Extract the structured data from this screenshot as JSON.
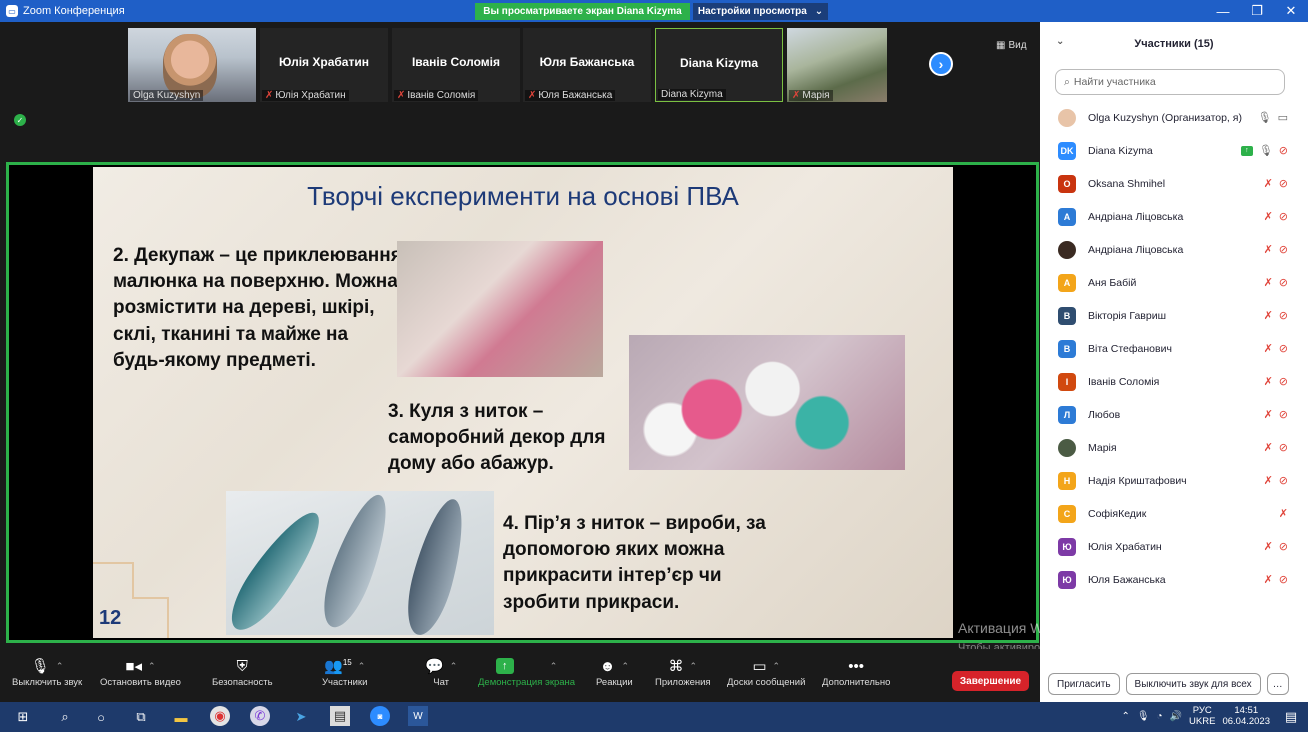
{
  "window": {
    "title": "Zoom Конференция",
    "viewing_banner": "Вы просматриваете экран Diana Kizyma",
    "view_settings": "Настройки просмотра"
  },
  "thumbnails": [
    {
      "name": "",
      "label": "Olga Kuzyshyn",
      "muted": false
    },
    {
      "name": "Юлія Храбатин",
      "label": "Юлія Храбатин",
      "muted": true
    },
    {
      "name": "Іванів Соломія",
      "label": "Іванів Соломія",
      "muted": true
    },
    {
      "name": "Юля Бажанська",
      "label": "Юля Бажанська",
      "muted": true
    },
    {
      "name": "Diana Kizyma",
      "label": "Diana Kizyma",
      "muted": false
    },
    {
      "name": "",
      "label": "Марія",
      "muted": true
    }
  ],
  "view_button": "Вид",
  "slide": {
    "title": "Творчі експерименти на основі ПВА",
    "text1": "2. Декупаж – це приклеювання малюнка на поверхню. Можна розмістити на дереві, шкірі, склі, тканині та майже на будь-якому предметі.",
    "text2": "3. Куля з ниток – саморобний декор для дому або абажур.",
    "text3": "4. Пір’я з ниток – вироби, за допомогою яких можна прикрасити інтер’єр чи зробити прикраси.",
    "number": "12"
  },
  "watermark": {
    "line1": "Активация Windows",
    "line2": "Чтобы активировать Windows, перейдите в раздел \"Параметры\"."
  },
  "toolbar": {
    "mute": "Выключить звук",
    "stop_video": "Остановить видео",
    "security": "Безопасность",
    "participants": "Участники",
    "participants_count": "15",
    "chat": "Чат",
    "share": "Демонстрация экрана",
    "reactions": "Реакции",
    "apps": "Приложения",
    "whiteboards": "Доски сообщений",
    "more": "Дополнительно",
    "end": "Завершение"
  },
  "panel": {
    "title": "Участники (15)",
    "search_placeholder": "Найти участника",
    "invite": "Пригласить",
    "mute_all": "Выключить звук для всех",
    "more": "…",
    "participants": [
      {
        "name": "Olga Kuzyshyn (Организатор, я)",
        "initial": "",
        "color": "#e8c4a8",
        "photo": true
      },
      {
        "name": "Diana Kizyma",
        "initial": "DK",
        "color": "#2d8cff"
      },
      {
        "name": "Oksana Shmihel",
        "initial": "O",
        "color": "#c9340f"
      },
      {
        "name": "Андріана Ліцовська",
        "initial": "A",
        "color": "#2d7bd6"
      },
      {
        "name": "Андріана Ліцовська",
        "initial": "",
        "color": "#3a2a22",
        "photo": true
      },
      {
        "name": "Аня Бабій",
        "initial": "A",
        "color": "#f3a51a"
      },
      {
        "name": "Вікторія Гавриш",
        "initial": "B",
        "color": "#2f4d70"
      },
      {
        "name": "Віта Стефанович",
        "initial": "B",
        "color": "#2d7bd6"
      },
      {
        "name": "Іванів Соломія",
        "initial": "I",
        "color": "#d1490f"
      },
      {
        "name": "Любов",
        "initial": "Л",
        "color": "#2d7bd6"
      },
      {
        "name": "Марія",
        "initial": "",
        "color": "#4b5b44",
        "photo": true
      },
      {
        "name": "Надія Криштафович",
        "initial": "H",
        "color": "#f3a51a"
      },
      {
        "name": "СофіяКедик",
        "initial": "C",
        "color": "#f3a51a"
      },
      {
        "name": "Юлія Храбатин",
        "initial": "Ю",
        "color": "#7d3aa6"
      },
      {
        "name": "Юля Бажанська",
        "initial": "Ю",
        "color": "#7d3aa6"
      }
    ]
  },
  "taskbar": {
    "lang1": "РУС",
    "lang2": "UKRE",
    "time": "14:51",
    "date": "06.04.2023"
  }
}
